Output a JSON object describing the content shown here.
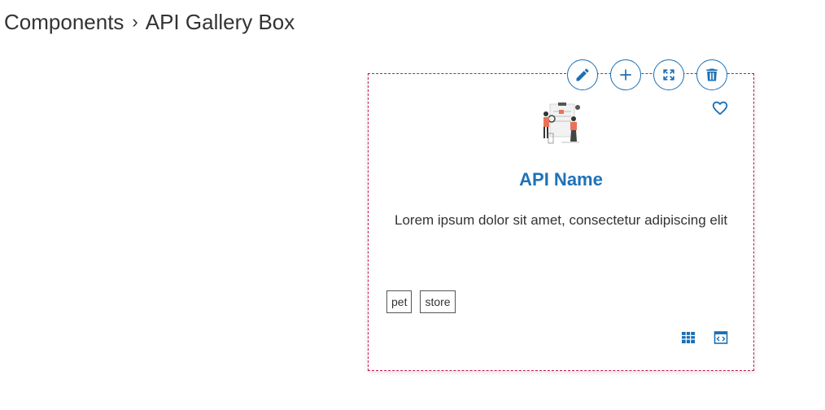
{
  "breadcrumb": {
    "parent": "Components",
    "separator": "›",
    "current": "API Gallery Box"
  },
  "toolbar": {
    "buttons": [
      {
        "icon": "pencil-icon",
        "action": "edit"
      },
      {
        "icon": "plus-icon",
        "action": "add"
      },
      {
        "icon": "expand-icon",
        "action": "fullscreen"
      },
      {
        "icon": "trash-icon",
        "action": "delete"
      }
    ]
  },
  "card": {
    "favorite_icon": "heart-outline-icon",
    "illustration": "people-with-clipboard-illustration",
    "title": "API Name",
    "description": "Lorem ipsum dolor sit amet, consectetur adipiscing elit",
    "tags": [
      "pet",
      "store"
    ],
    "footer_icons": [
      "table-icon",
      "code-icon"
    ]
  },
  "colors": {
    "accent": "#1f72b8",
    "border": "#c2185b",
    "text": "#333333"
  }
}
